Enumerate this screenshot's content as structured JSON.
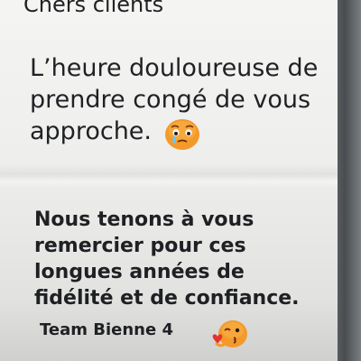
{
  "sign": {
    "heading": "Chers clients",
    "paragraph1": {
      "lines": [
        "L’heure douloureuse de",
        "prendre congé de vous",
        "approche."
      ]
    },
    "paragraph2": {
      "lines": [
        "Nous tenons à vous",
        "remercier pour ces",
        "longues années de",
        "fidélité et de confiance."
      ]
    },
    "signature": "Team Bienne 4"
  },
  "emojis": [
    {
      "name": "crying-face-emoji",
      "color": "#f39a2b"
    },
    {
      "name": "kissing-face-emoji",
      "color": "#f39a2b"
    }
  ],
  "colors": {
    "paper": "#f0f0ee",
    "text": "#1e2023",
    "emoji": "#f39a2b",
    "background": "#3a3d40"
  }
}
